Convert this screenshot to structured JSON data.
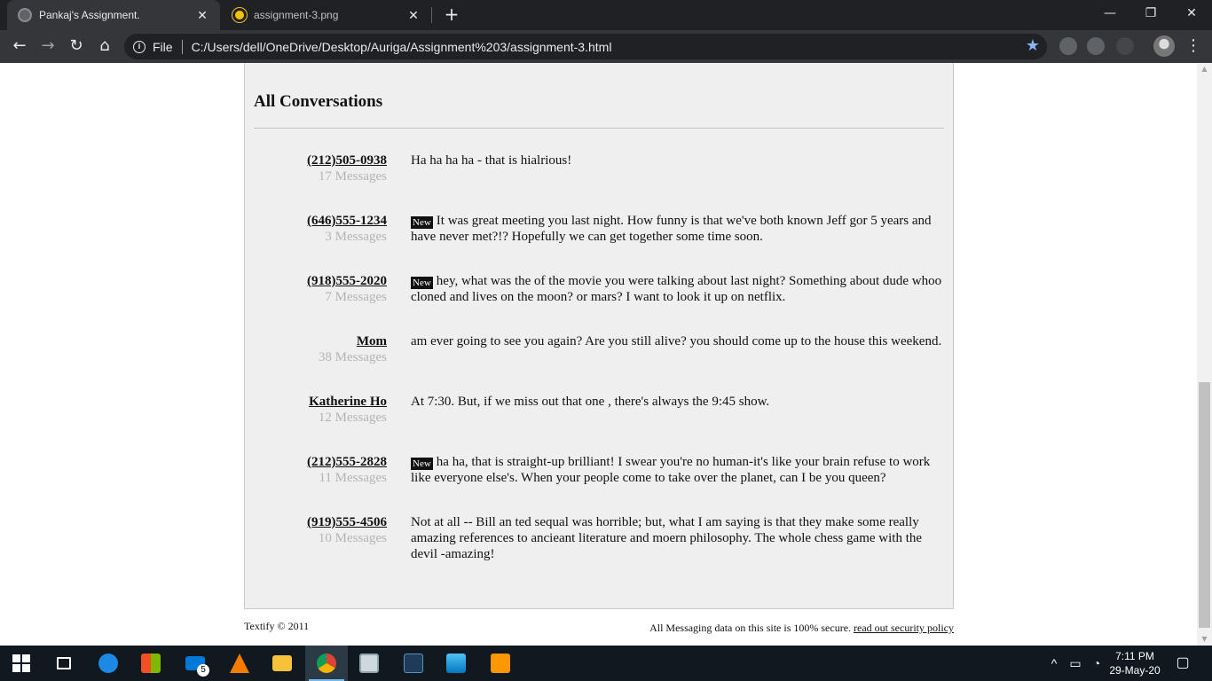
{
  "browser": {
    "tabs": [
      {
        "title": "Pankaj's Assignment.",
        "close": "✕"
      },
      {
        "title": "assignment-3.png",
        "close": "✕"
      }
    ],
    "new_tab": "+",
    "window_controls": {
      "minimize": "—",
      "restore": "❐",
      "close": "✕"
    },
    "nav": {
      "back": "←",
      "forward": "→",
      "reload": "↻",
      "home": "⌂"
    },
    "address": {
      "scheme_label": "File",
      "info_glyph": "i",
      "url": "C:/Users/dell/OneDrive/Desktop/Auriga/Assignment%203/assignment-3.html",
      "star": "★"
    },
    "menu": "⋮"
  },
  "page": {
    "heading": "All Conversations",
    "conversations": [
      {
        "name": "(212)505-0938",
        "count": "17 Messages",
        "new": false,
        "message": "Ha ha ha ha - that is hialrious!"
      },
      {
        "name": "(646)555-1234",
        "count": "3 Messages",
        "new": true,
        "message": "It was great meeting you last night. How funny is that we've both known Jeff gor 5 years and have never met?!? Hopefully we can get together some time soon."
      },
      {
        "name": "(918)555-2020",
        "count": "7 Messages",
        "new": true,
        "message": "hey, what was the of the movie you were talking about last night? Something about dude whoo cloned and lives on the moon? or mars? I want to look it up on netflix."
      },
      {
        "name": "Mom",
        "count": "38 Messages",
        "new": false,
        "message": "am ever going to see you again? Are you still alive? you should come up to the house this weekend."
      },
      {
        "name": "Katherine Ho",
        "count": "12 Messages",
        "new": false,
        "message": "At 7:30. But, if we miss out that one , there's always the 9:45 show."
      },
      {
        "name": "(212)555-2828",
        "count": "11 Messages",
        "new": true,
        "message": "ha ha, that is straight-up brilliant! I swear you're no human-it's like your brain refuse to work like everyone else's. When your people come to take over the planet, can I be you queen?"
      },
      {
        "name": "(919)555-4506",
        "count": "10 Messages",
        "new": false,
        "message": "Not at all -- Bill an ted sequal was horrible; but, what I am saying is that they make some really amazing references to ancieant literature and moern philosophy. The whole chess game with the devil -amazing!"
      }
    ],
    "new_badge": "New",
    "footer": {
      "copyright": "Textify © 2011",
      "security_text": "All Messaging data on this site is 100% secure.",
      "security_link": "read out security policy"
    }
  },
  "taskbar": {
    "mail_badge": "5",
    "clock_time": "7:11 PM",
    "clock_date": "29-May-20",
    "tray_glyphs": {
      "chevron": "^",
      "notifications": "▢"
    }
  }
}
